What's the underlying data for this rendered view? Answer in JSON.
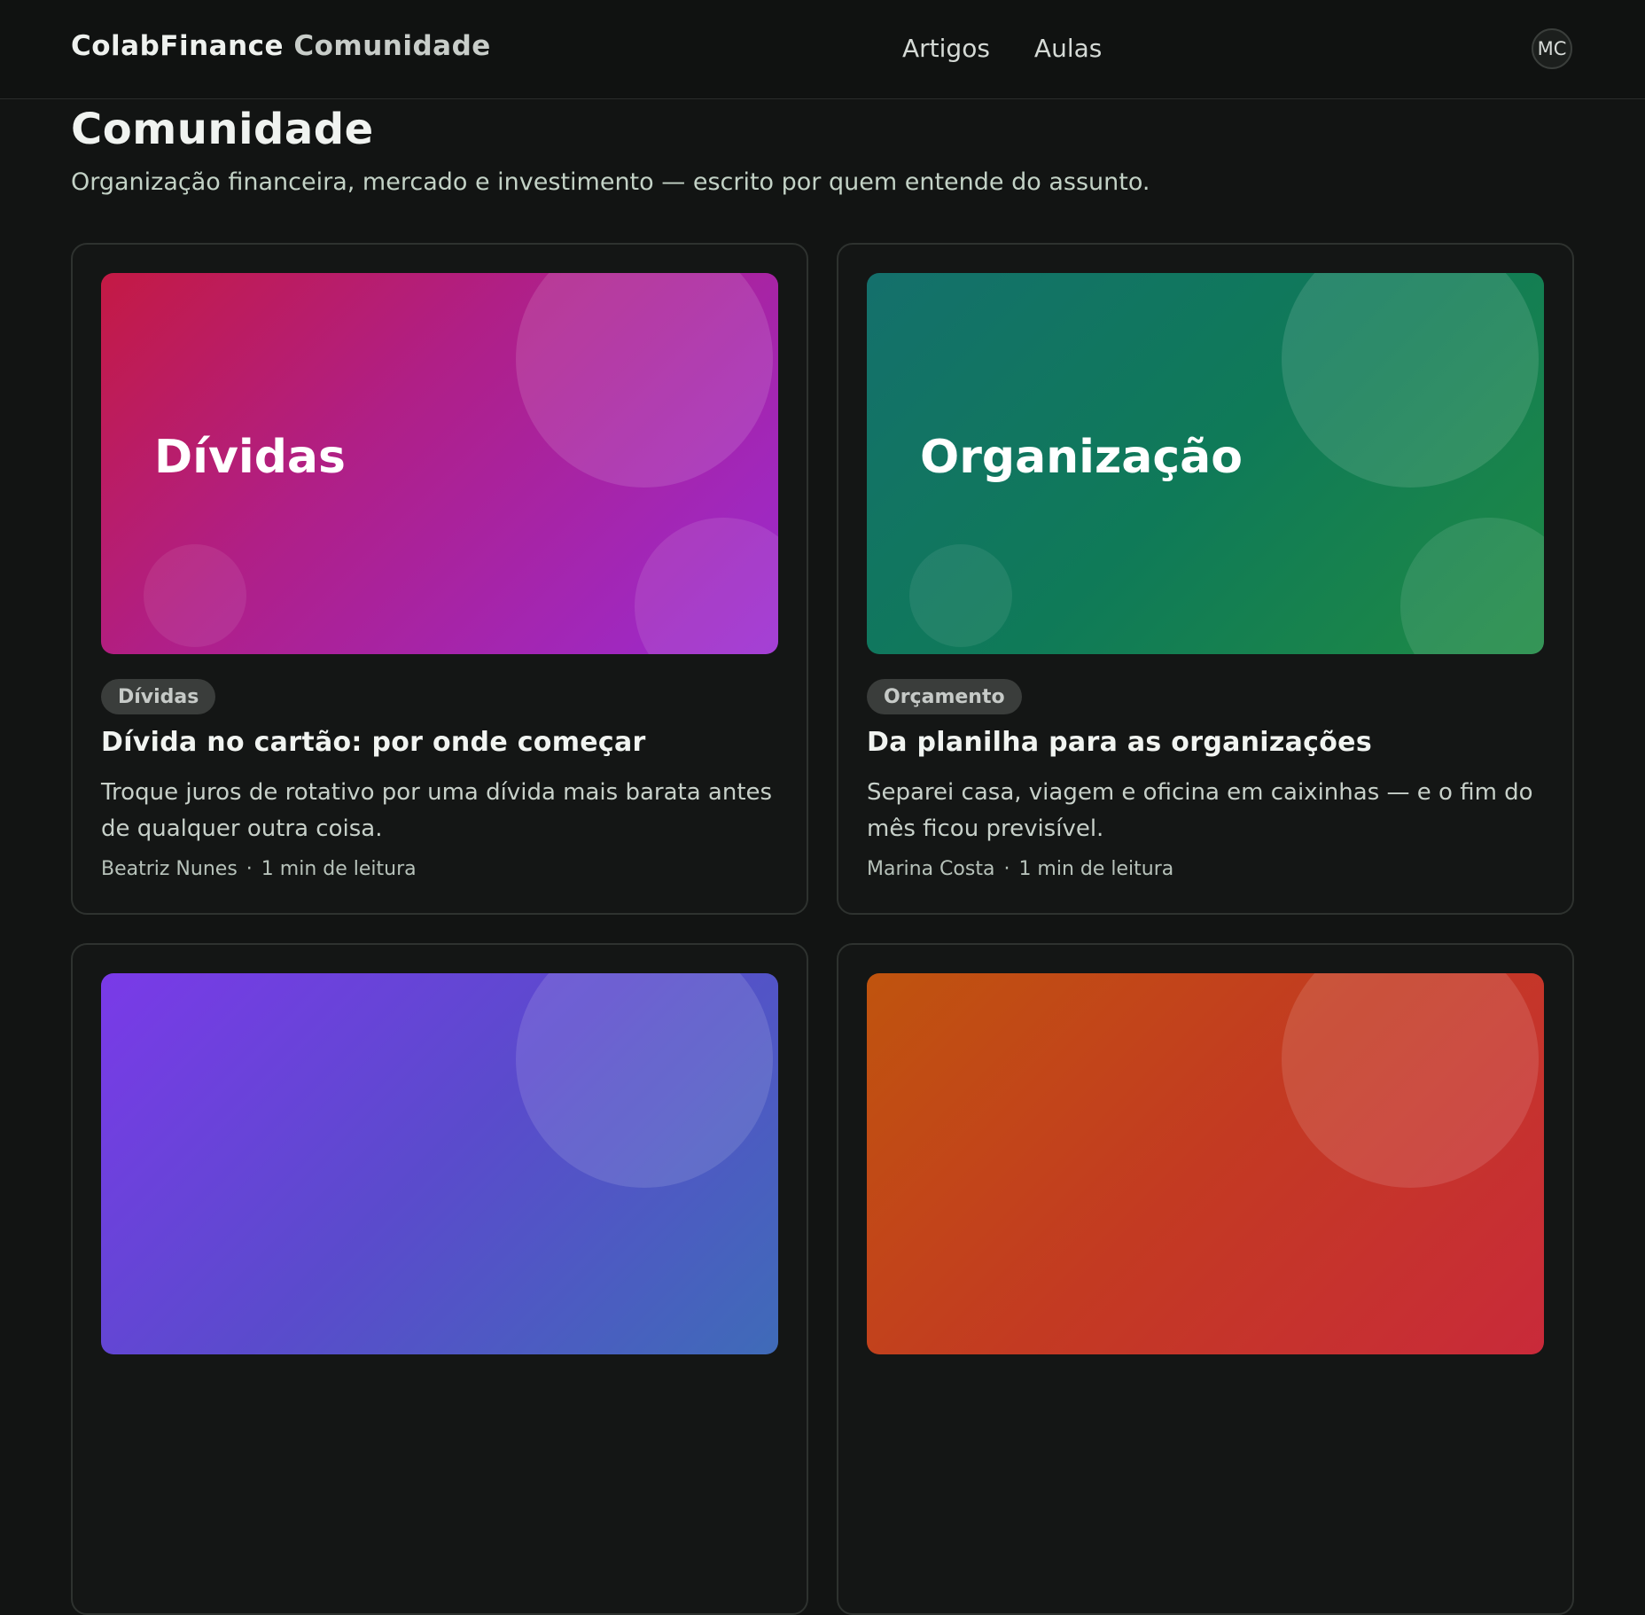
{
  "header": {
    "brand_main": "ColabFinance",
    "brand_sub": "Comunidade",
    "nav": [
      "Artigos",
      "Aulas"
    ],
    "avatar_initials": "MC"
  },
  "page": {
    "title": "Comunidade",
    "subtitle": "Organização financeira, mercado e investimento — escrito por quem entende do assunto."
  },
  "cards": [
    {
      "cover_label": "Dívidas",
      "tag": "Dívidas",
      "title": "Dívida no cartão: por onde começar",
      "excerpt": "Troque juros de rotativo por uma dívida mais barata antes de qualquer outra coisa.",
      "author": "Beatriz Nunes",
      "read_time": "1 min de leitura",
      "colors": [
        "#c41a44",
        "#9a2bd2"
      ]
    },
    {
      "cover_label": "Organização",
      "tag": "Orçamento",
      "title": "Da planilha para as organizações",
      "excerpt": "Separei casa, viagem e oficina em caixinhas — e o fim do mês ficou previsível.",
      "author": "Marina Costa",
      "read_time": "1 min de leitura",
      "colors": [
        "#14706c",
        "#1f8a44"
      ]
    },
    {
      "colors": [
        "#7a3ae8",
        "#3f6bb8"
      ]
    },
    {
      "colors": [
        "#c0540e",
        "#c92a3a"
      ]
    }
  ]
}
